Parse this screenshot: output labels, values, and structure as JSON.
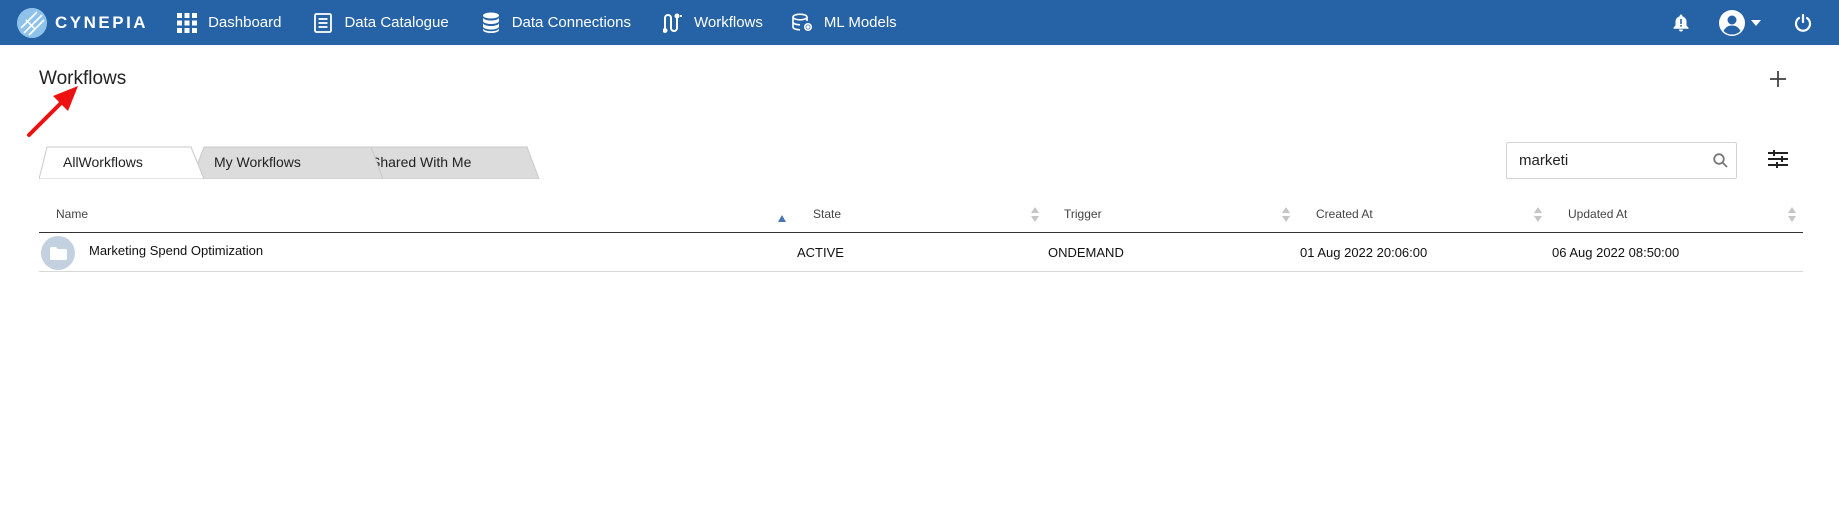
{
  "brand": {
    "name": "CYNEPIA",
    "logo_icon": "cynepia-logo-icon"
  },
  "nav": {
    "items": [
      {
        "label": "Dashboard",
        "icon": "grid-icon"
      },
      {
        "label": "Data Catalogue",
        "icon": "document-icon"
      },
      {
        "label": "Data Connections",
        "icon": "database-icon"
      },
      {
        "label": "Workflows",
        "icon": "workflow-icon"
      },
      {
        "label": "ML Models",
        "icon": "ml-models-icon"
      }
    ],
    "right_icons": [
      "bell-icon",
      "user-avatar-icon",
      "caret-down-icon",
      "power-icon"
    ]
  },
  "colors": {
    "topbar": "#2563a6",
    "accent": "#4a73b8",
    "annotation_arrow": "#ee1111"
  },
  "page": {
    "title": "Workflows",
    "add_icon": "plus-icon",
    "filter_icon": "sliders-icon"
  },
  "tabs": [
    {
      "label": "AllWorkflows",
      "active": true
    },
    {
      "label": "My Workflows",
      "active": false
    },
    {
      "label": "Shared With Me",
      "active": false
    }
  ],
  "search": {
    "value": "marketi",
    "icon": "search-icon"
  },
  "table": {
    "columns": [
      {
        "label": "Name",
        "sort": "asc"
      },
      {
        "label": "State",
        "sort": "none"
      },
      {
        "label": "Trigger",
        "sort": "none"
      },
      {
        "label": "Created At",
        "sort": "none"
      },
      {
        "label": "Updated At",
        "sort": "none"
      }
    ],
    "rows": [
      {
        "icon": "folder-icon",
        "name": "Marketing Spend Optimization",
        "state": "ACTIVE",
        "trigger": "ONDEMAND",
        "created_at": "01 Aug 2022 20:06:00",
        "updated_at": "06 Aug 2022 08:50:00"
      }
    ]
  }
}
